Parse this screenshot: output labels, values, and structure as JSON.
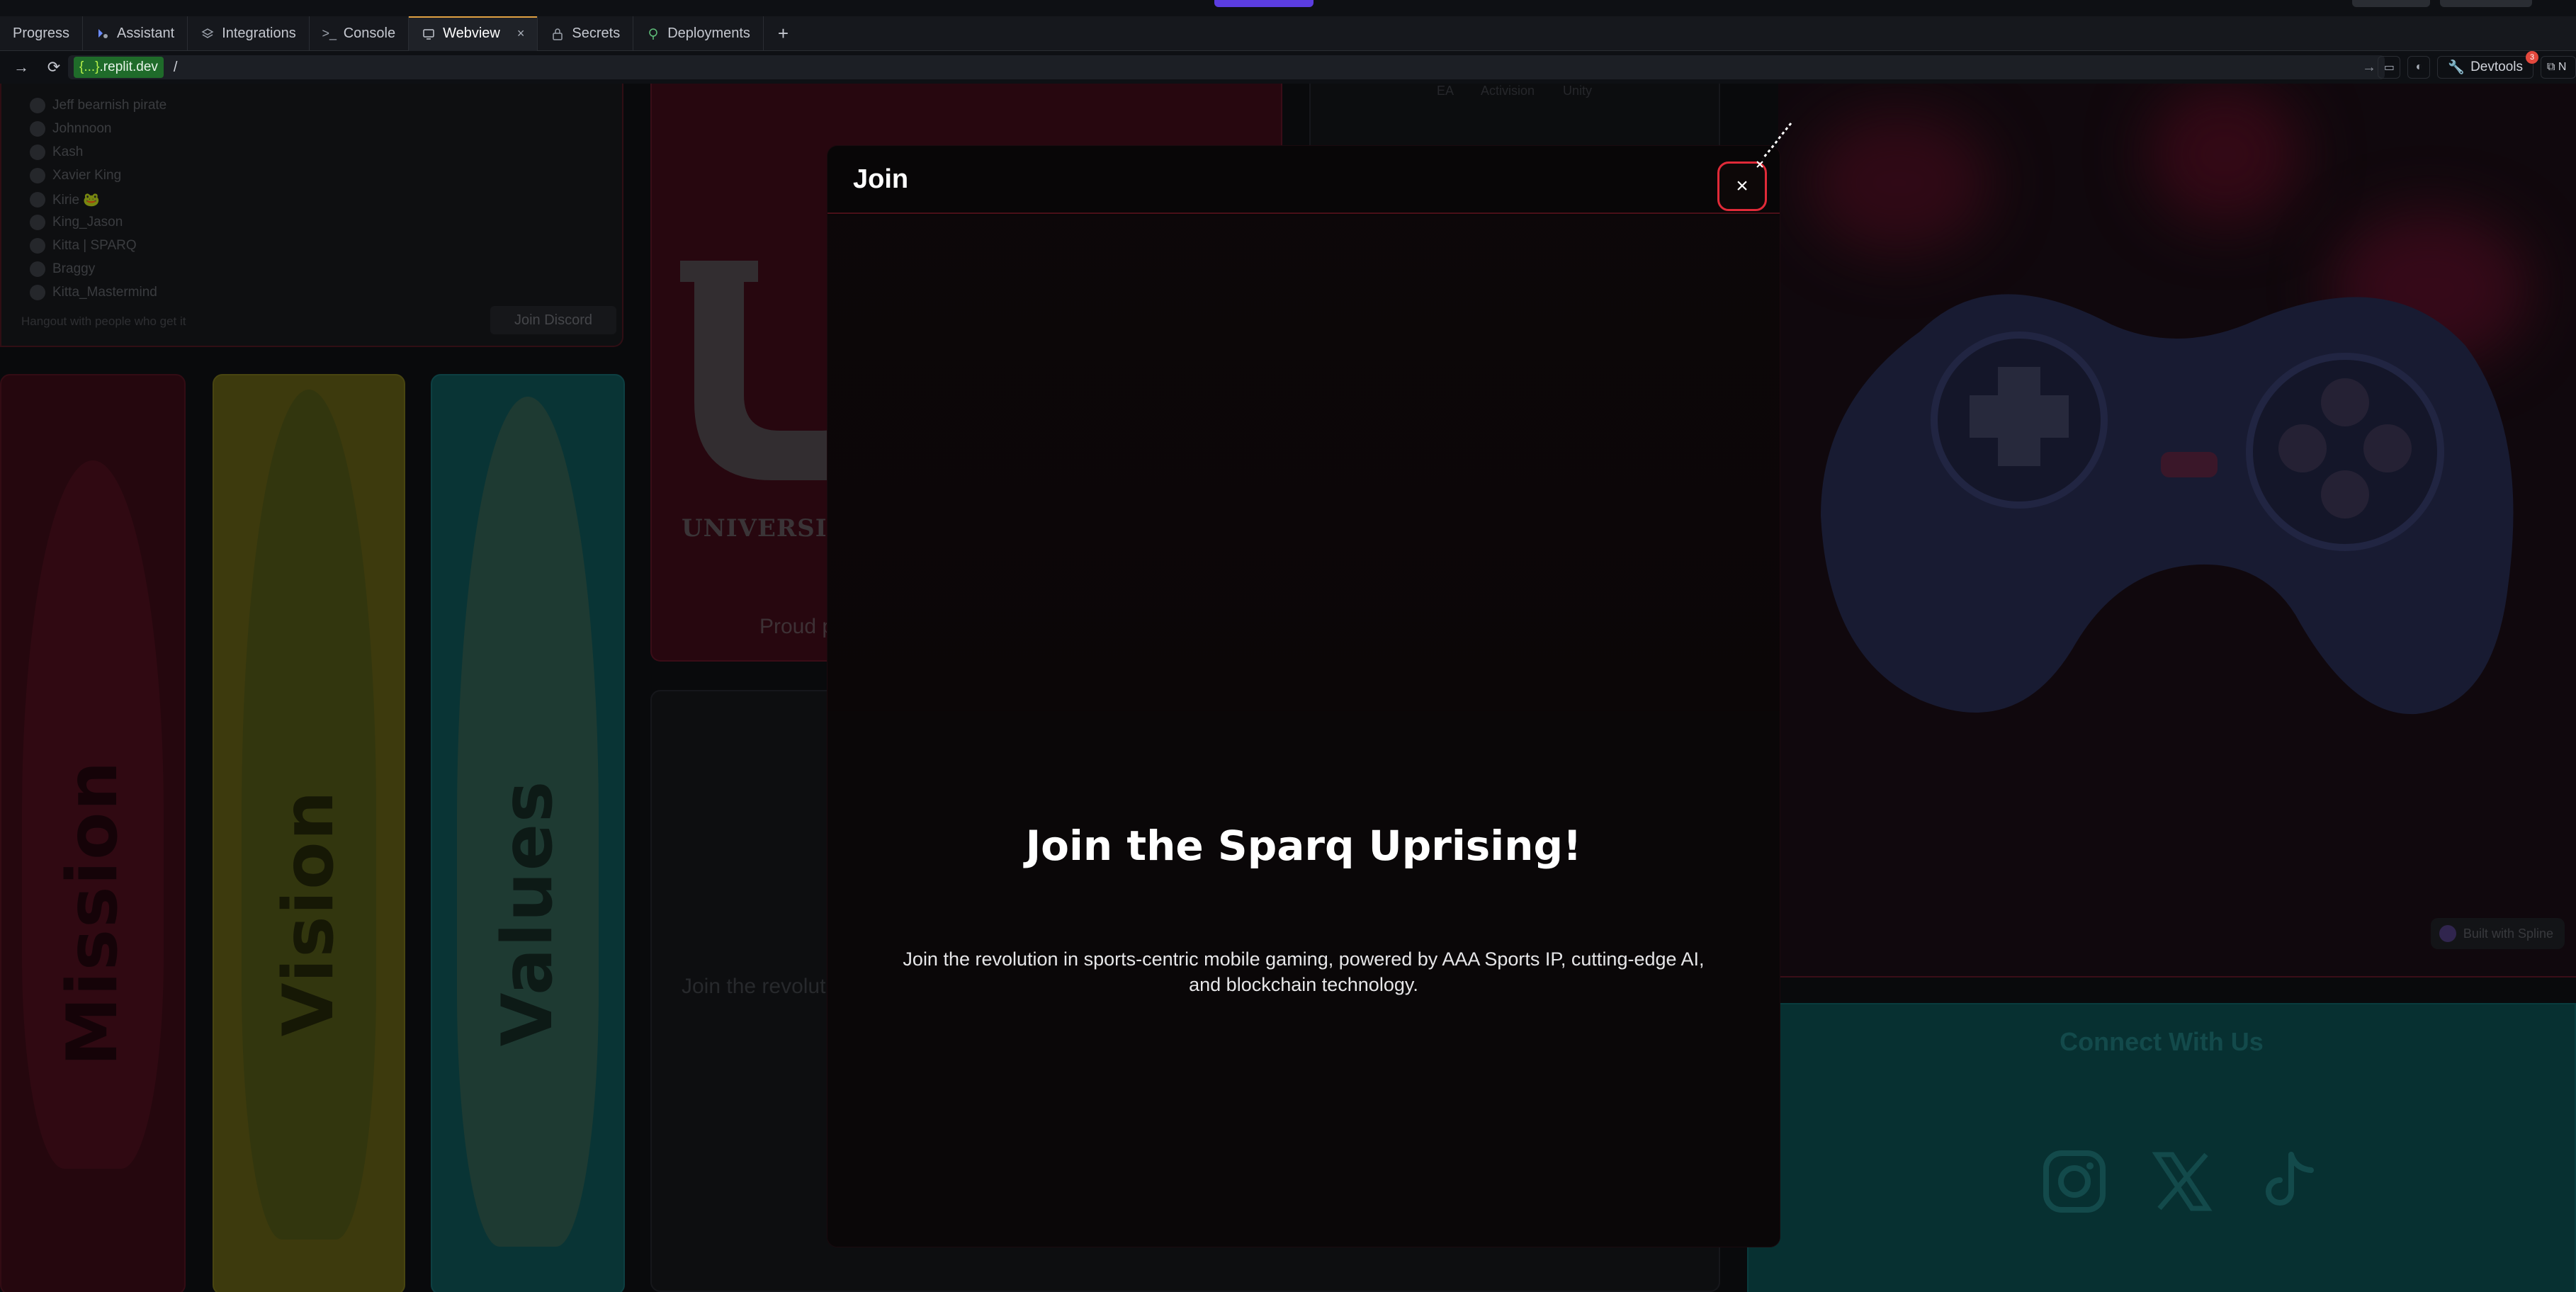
{
  "ide": {
    "tabs": [
      {
        "label": "Progress",
        "icon": "none"
      },
      {
        "label": "Assistant",
        "icon": "assistant-icon"
      },
      {
        "label": "Integrations",
        "icon": "layers-icon"
      },
      {
        "label": "Console",
        "icon": "terminal-icon"
      },
      {
        "label": "Webview",
        "icon": "monitor-icon",
        "active": true
      },
      {
        "label": "Secrets",
        "icon": "lock-icon"
      },
      {
        "label": "Deployments",
        "icon": "deploy-icon"
      }
    ],
    "add_tab": "+",
    "url": {
      "domain_prefix": "{...}",
      "domain_suffix": ".replit.dev",
      "path": "/"
    },
    "devtools_label": "Devtools",
    "devtools_badge": "3",
    "accent_color": "#e0a142"
  },
  "page": {
    "discord": {
      "members": [
        "Jeff bearnish pirate",
        "Johnnoon",
        "Kash",
        "Xavier King",
        "Kirie 🐸",
        "King_Jason",
        "Kitta | SPARQ",
        "Braggy",
        "Kitta_Mastermind"
      ],
      "hangout_text": "Hangout with people who get it",
      "join_button": "Join Discord"
    },
    "cards": {
      "mission": "Mission",
      "vision": "Vision",
      "values": "Values"
    },
    "utah": {
      "university_text": "UNIVERSITY",
      "proud_text": "Proud p"
    },
    "join_panel_text": "Join the revoluti",
    "partners": [
      "EA",
      "Activision",
      "Unity"
    ],
    "spline_badge": "Built with Spline",
    "connect_title": "Connect With Us",
    "social_icons": [
      "instagram-icon",
      "x-icon",
      "tiktok-icon"
    ]
  },
  "modal": {
    "title": "Join",
    "close_symbol": "×",
    "heading": "Join the Sparq Uprising!",
    "description": "Join the revolution in sports-centric mobile gaming, powered by AAA Sports IP, cutting-edge AI, and blockchain technology."
  }
}
